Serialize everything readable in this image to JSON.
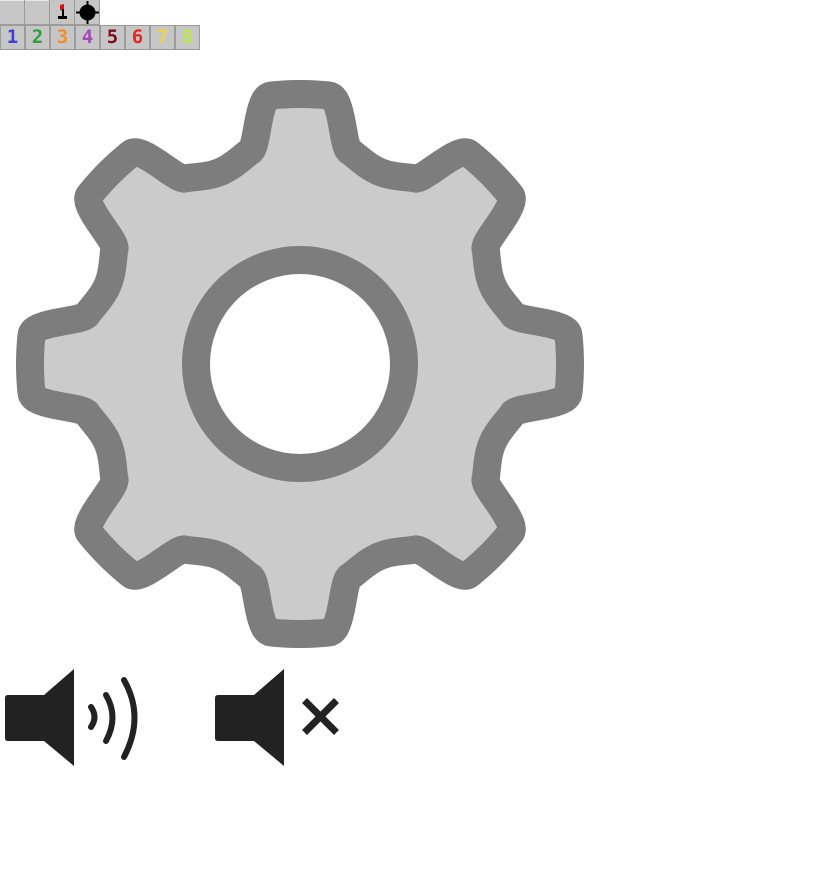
{
  "sprites": {
    "top_row": [
      {
        "name": "unrevealed-tile",
        "icon": "raised-tile-icon"
      },
      {
        "name": "unrevealed-tile",
        "icon": "raised-tile-icon"
      },
      {
        "name": "flag-tile",
        "icon": "flag-icon"
      },
      {
        "name": "mine-tile",
        "icon": "mine-icon"
      }
    ],
    "numbers": [
      {
        "label": "1",
        "color": "#3f3fd6"
      },
      {
        "label": "2",
        "color": "#2e9e3e"
      },
      {
        "label": "3",
        "color": "#f0902a"
      },
      {
        "label": "4",
        "color": "#a44ab8"
      },
      {
        "label": "5",
        "color": "#7e0a1c"
      },
      {
        "label": "6",
        "color": "#e8261c"
      },
      {
        "label": "7",
        "color": "#eed34a"
      },
      {
        "label": "8",
        "color": "#bde84a"
      }
    ]
  },
  "icons": {
    "settings": "gear-icon",
    "sound_on": "speaker-on-icon",
    "sound_off": "speaker-muted-icon"
  },
  "colors": {
    "gear_fill": "#cbcbcb",
    "gear_outline": "#7d7d7d",
    "speaker": "#222222",
    "tile": "#c6c6c6",
    "flag": "#e01010"
  }
}
